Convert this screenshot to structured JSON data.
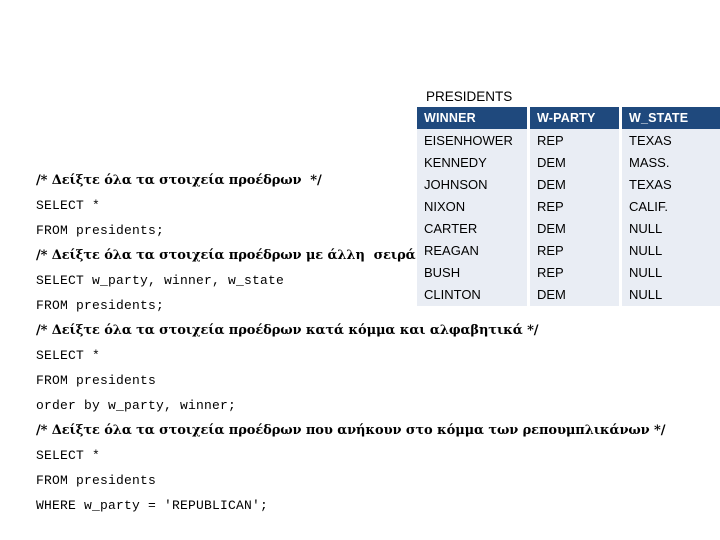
{
  "table": {
    "title": "PRESIDENTS",
    "columns": [
      "WINNER",
      "W-PARTY",
      "W_STATE"
    ],
    "rows": [
      [
        "EISENHOWER",
        "REP",
        "TEXAS"
      ],
      [
        "KENNEDY",
        "DEM",
        "MASS."
      ],
      [
        "JOHNSON",
        "DEM",
        "TEXAS"
      ],
      [
        "NIXON",
        "REP",
        "CALIF."
      ],
      [
        "CARTER",
        "DEM",
        "NULL"
      ],
      [
        "REAGAN",
        "REP",
        "NULL"
      ],
      [
        "BUSH",
        "REP",
        "NULL"
      ],
      [
        "CLINTON",
        "DEM",
        "NULL"
      ]
    ],
    "header_color": "#1F497D",
    "row_color": "#E9EDF4"
  },
  "code": {
    "lines": [
      {
        "kind": "comment",
        "text": "/* Δείξτε όλα τα στοιχεία προέδρων  */"
      },
      {
        "kind": "sql",
        "text": "SELECT *"
      },
      {
        "kind": "sql",
        "text": "FROM presidents;"
      },
      {
        "kind": "comment",
        "text": "/* Δείξτε όλα τα στοιχεία προέδρων με άλλη  σειρά   */"
      },
      {
        "kind": "sql",
        "text": "SELECT w_party, winner, w_state"
      },
      {
        "kind": "sql",
        "text": "FROM presidents;"
      },
      {
        "kind": "comment",
        "text": "/* Δείξτε όλα τα στοιχεία προέδρων κατά κόμμα και αλφαβητικά */"
      },
      {
        "kind": "sql",
        "text": "SELECT *"
      },
      {
        "kind": "sql",
        "text": "FROM presidents"
      },
      {
        "kind": "sql",
        "text": "order by w_party, winner;"
      },
      {
        "kind": "comment",
        "text": "/* Δείξτε όλα τα στοιχεία προέδρων που ανήκουν στο κόμμα των ρεπουμπλικάνων */"
      },
      {
        "kind": "sql",
        "text": "SELECT *"
      },
      {
        "kind": "sql",
        "text": "FROM presidents"
      },
      {
        "kind": "sql",
        "text": "WHERE w_party = 'REPUBLICAN';"
      }
    ]
  }
}
